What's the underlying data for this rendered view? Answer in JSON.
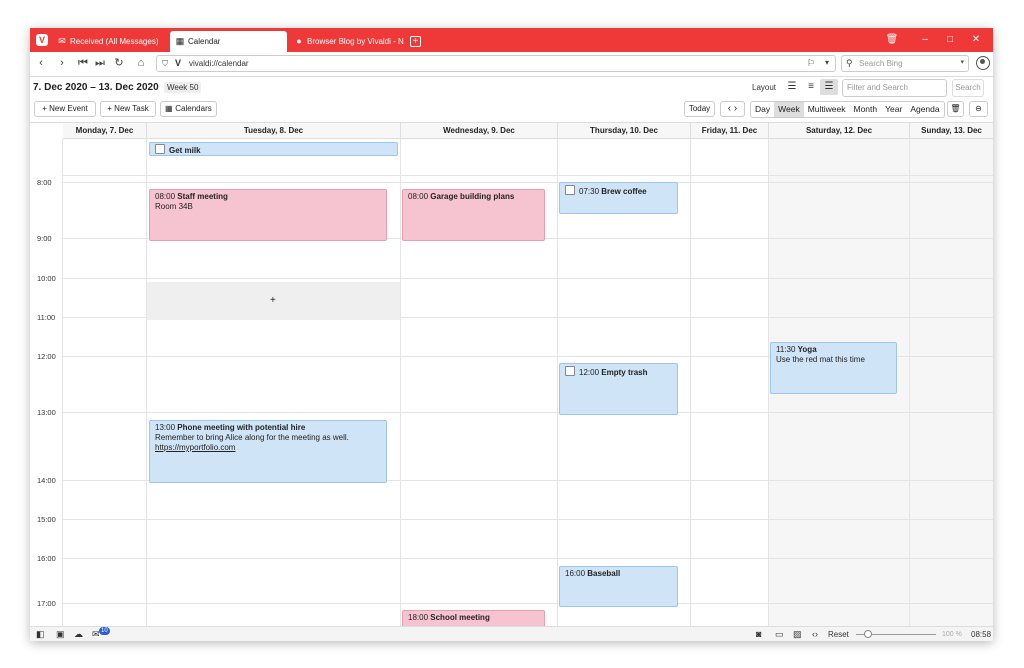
{
  "tabs": [
    {
      "label": "Received (All Messages)",
      "icon": "mail-icon"
    },
    {
      "label": "Calendar",
      "icon": "calendar-icon"
    },
    {
      "label": "Browser Blog by Vivaldi - N",
      "icon": "vivaldi-icon"
    }
  ],
  "address": {
    "url": "vivaldi://calendar"
  },
  "search": {
    "placeholder": "Search Bing"
  },
  "calendar": {
    "date_range": "7. Dec 2020 – 13. Dec 2020",
    "week": "Week 50",
    "layout_label": "Layout",
    "filter_placeholder": "Filter and Search",
    "search_button": "Search",
    "new_event": "+ New Event",
    "new_task": "+ New Task",
    "calendars": "Calendars",
    "today": "Today",
    "views": [
      "Day",
      "Week",
      "Multiweek",
      "Month",
      "Year",
      "Agenda"
    ],
    "selected_view": "Week",
    "days": [
      "Monday, 7. Dec",
      "Tuesday, 8. Dec",
      "Wednesday, 9. Dec",
      "Thursday, 10. Dec",
      "Friday, 11. Dec",
      "Saturday, 12. Dec",
      "Sunday, 13. Dec"
    ],
    "hours": [
      "8:00",
      "9:00",
      "10:00",
      "11:00",
      "12:00",
      "13:00",
      "14:00",
      "15:00",
      "16:00",
      "17:00"
    ],
    "add_slot": "+",
    "events": {
      "get_milk": {
        "title": "Get milk"
      },
      "staff_meeting": {
        "time": "08:00",
        "title": "Staff meeting",
        "note": "Room 34B"
      },
      "garage": {
        "time": "08:00",
        "title": "Garage building plans"
      },
      "brew_coffee": {
        "time": "07:30",
        "title": "Brew coffee"
      },
      "yoga": {
        "time": "11:30",
        "title": "Yoga",
        "note": "Use the red mat this time"
      },
      "empty_trash": {
        "time": "12:00",
        "title": "Empty trash"
      },
      "phone_meeting": {
        "time": "13:00",
        "title": "Phone meeting with potential hire",
        "note": "Remember to bring Alice along for the meeting as well.",
        "link": "https://myportfolio.com"
      },
      "baseball": {
        "time": "16:00",
        "title": "Baseball"
      },
      "school_meeting": {
        "time": "18:00",
        "title": "School meeting"
      }
    }
  },
  "status": {
    "badge": "10",
    "reset": "Reset",
    "zoom": "100 %",
    "clock": "08:58"
  },
  "colors": {
    "accent": "#ef3939",
    "event_blue": "#cfe4f7",
    "event_pink": "#f6c4d1"
  }
}
